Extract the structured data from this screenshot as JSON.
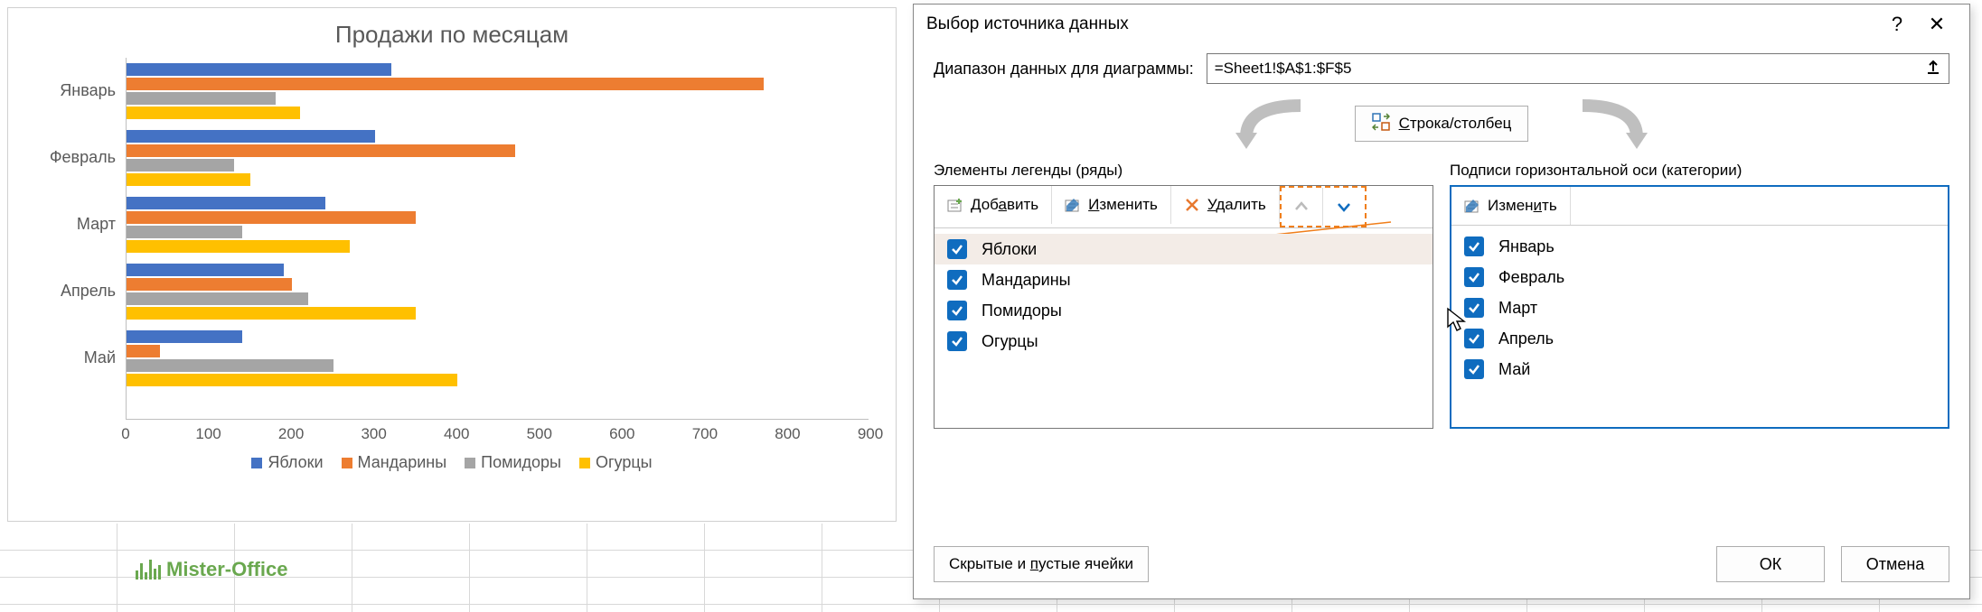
{
  "chart_data": {
    "type": "bar",
    "orientation": "horizontal",
    "title": "Продажи по месяцам",
    "categories": [
      "Январь",
      "Февраль",
      "Март",
      "Апрель",
      "Май"
    ],
    "series": [
      {
        "name": "Яблоки",
        "color": "#4472C4",
        "values": [
          320,
          300,
          240,
          190,
          140
        ]
      },
      {
        "name": "Мандарины",
        "color": "#ED7D31",
        "values": [
          770,
          470,
          350,
          200,
          40
        ]
      },
      {
        "name": "Помидоры",
        "color": "#A5A5A5",
        "values": [
          180,
          130,
          140,
          220,
          250
        ]
      },
      {
        "name": "Огурцы",
        "color": "#FFC000",
        "values": [
          210,
          150,
          270,
          350,
          400
        ]
      }
    ],
    "xlabel": "",
    "ylabel": "",
    "xlim": [
      0,
      900
    ],
    "x_ticks": [
      0,
      100,
      200,
      300,
      400,
      500,
      600,
      700,
      800,
      900
    ],
    "legend_position": "bottom"
  },
  "logo_text": "Mister-Office",
  "dialog": {
    "title": "Выбор источника данных",
    "help_tooltip": "?",
    "close_tooltip": "✕",
    "range_label": "Диапазон данных для диаграммы:",
    "range_value": "=Sheet1!$A$1:$F$5",
    "switch_btn": "Строка/столбец",
    "switch_accel": "С",
    "legend_panel_label": "Элементы легенды (ряды)",
    "axis_panel_label": "Подписи горизонтальной оси (категории)",
    "btn_add": "Добавить",
    "btn_add_accel": "а",
    "btn_edit": "Изменить",
    "btn_edit_accel": "И",
    "btn_edit2": "Изменить",
    "btn_edit2_accel": "и",
    "btn_delete": "Удалить",
    "btn_delete_accel": "У",
    "series_items": [
      "Яблоки",
      "Мандарины",
      "Помидоры",
      "Огурцы"
    ],
    "axis_items": [
      "Январь",
      "Февраль",
      "Март",
      "Апрель",
      "Май"
    ],
    "hidden_btn": "Скрытые и пустые ячейки",
    "hidden_accel": "п",
    "ok_btn": "ОК",
    "cancel_btn": "Отмена"
  }
}
